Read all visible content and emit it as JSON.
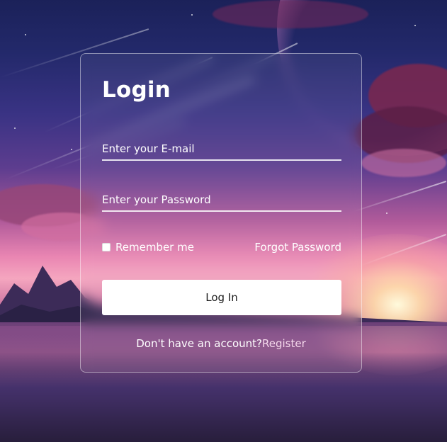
{
  "login": {
    "title": "Login",
    "email_placeholder": "Enter your E-mail",
    "password_placeholder": "Enter your Password",
    "remember_label": "Remember me",
    "remember_checked": false,
    "forgot_label": "Forgot Password",
    "submit_label": "Log In",
    "register_prompt": "Don't have an account?",
    "register_link": "Register"
  }
}
